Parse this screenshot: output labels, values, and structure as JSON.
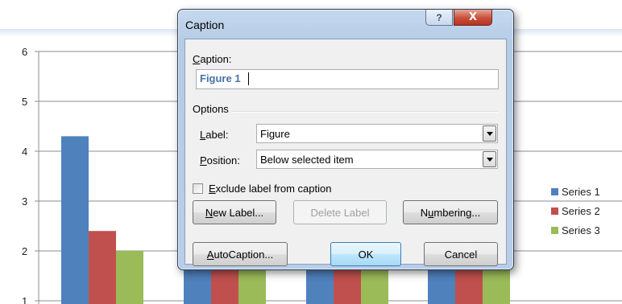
{
  "chart_data": {
    "type": "bar",
    "categories": [
      "",
      "",
      "",
      ""
    ],
    "series": [
      {
        "name": "Series 1",
        "values": [
          4.3,
          2.5,
          3.5,
          4.5
        ],
        "color": "#4f81bd"
      },
      {
        "name": "Series 2",
        "values": [
          2.4,
          4.4,
          1.8,
          2.8
        ],
        "color": "#c0504d"
      },
      {
        "name": "Series 3",
        "values": [
          2.0,
          2.0,
          3.0,
          5.0
        ],
        "color": "#9bbb59"
      }
    ],
    "y_ticks": [
      "1",
      "2",
      "3",
      "4",
      "5",
      "6"
    ],
    "ylim": [
      1,
      6
    ],
    "grid": true,
    "legend": "right"
  },
  "dialog": {
    "title": "Caption",
    "help_glyph": "?",
    "close_glyph": "X",
    "caption_label": "Caption:",
    "caption_value": "Figure 1",
    "options_label": "Options",
    "label_label": "Label:",
    "label_value": "Figure",
    "position_label": "Position:",
    "position_value": "Below selected item",
    "exclude_label": "Exclude label from caption",
    "exclude_checked": false,
    "new_label_button": "New Label...",
    "delete_label_button": "Delete Label",
    "numbering_button": "Numbering...",
    "autocaption_button": "AutoCaption...",
    "ok_button": "OK",
    "cancel_button": "Cancel"
  }
}
